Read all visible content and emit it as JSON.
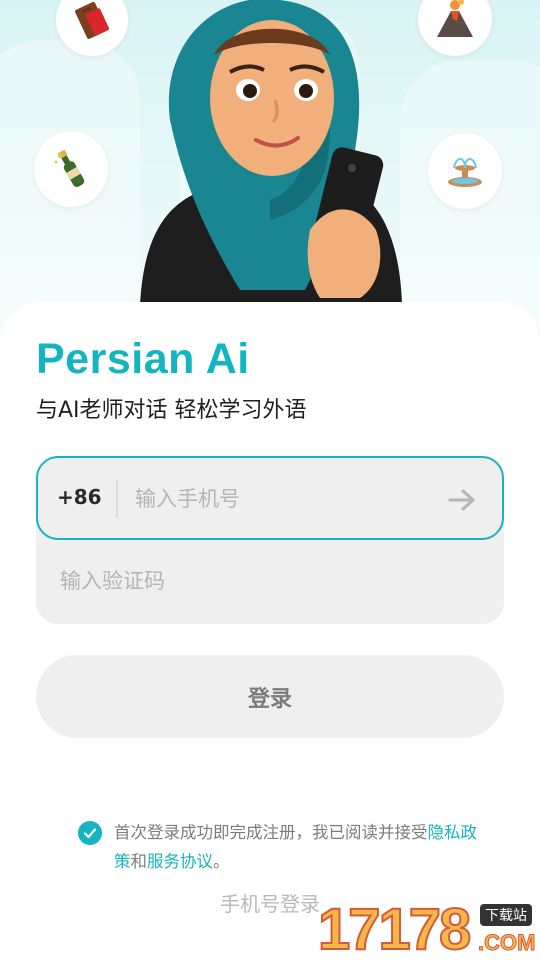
{
  "header": {
    "app_name": "Persian Ai",
    "subtitle": "与AI老师对话 轻松学习外语"
  },
  "hero": {
    "bubble_icons": [
      "chocolate-icon",
      "volcano-icon",
      "champagne-icon",
      "fountain-icon"
    ],
    "avatar": "hijab-avatar"
  },
  "form": {
    "country_code": "+86",
    "phone_placeholder": "输入手机号",
    "phone_value": "",
    "code_placeholder": "输入验证码",
    "code_value": ""
  },
  "login_button": "登录",
  "agreement": {
    "checked": true,
    "prefix": "首次登录成功即完成注册，我已阅读并接受",
    "privacy_link": "隐私政策",
    "conjunction": "和",
    "service_link": "服务协议",
    "suffix": "。"
  },
  "alt_login": "手机号登录",
  "watermark": {
    "number": "17178",
    "tag": "下载站",
    "domain": ".COM"
  },
  "colors": {
    "accent": "#14b4c0",
    "field_bg": "#efefef",
    "hero_bg": "#dff5f5"
  }
}
